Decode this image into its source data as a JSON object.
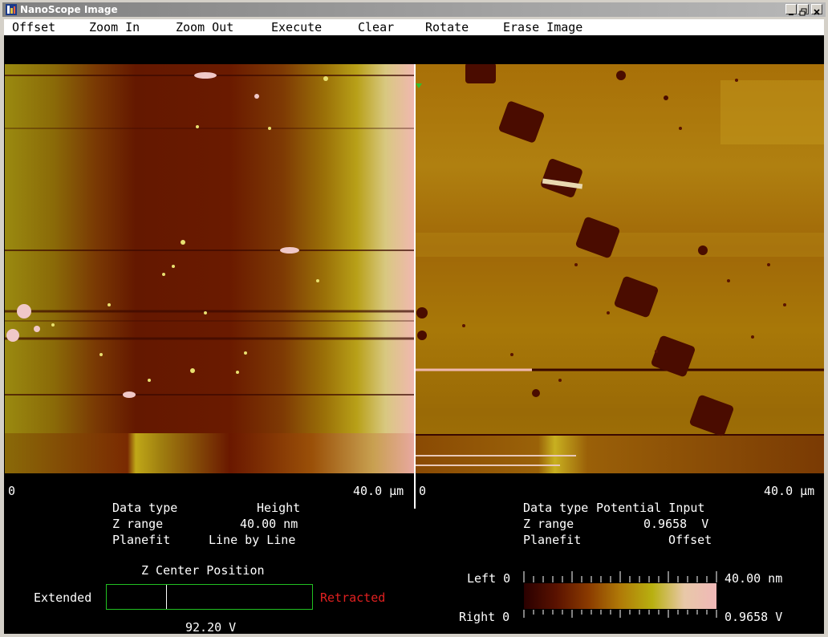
{
  "window": {
    "title": "NanoScope Image",
    "controls": [
      "minimize",
      "restore",
      "close"
    ]
  },
  "menu": {
    "items": [
      "Offset",
      "Zoom In",
      "Zoom Out",
      "Execute",
      "Clear",
      "Rotate",
      "Erase Image"
    ]
  },
  "left_image": {
    "scale_start": "0",
    "scale_end": "40.0 µm",
    "data_type_label": "Data type",
    "data_type_value": "Height",
    "z_range_label": "Z range",
    "z_range_value": "40.00 nm",
    "planefit_label": "Planefit",
    "planefit_value": "Line by Line"
  },
  "right_image": {
    "scale_start": "0",
    "scale_end": "40.0 µm",
    "data_type_label": "Data type",
    "data_type_value": "Potential Input",
    "z_range_label": "Z range",
    "z_range_value": "0.9658  V",
    "planefit_label": "Planefit",
    "planefit_value": "Offset"
  },
  "z_center": {
    "title": "Z Center Position",
    "extended_label": "Extended",
    "retracted_label": "Retracted",
    "voltage": "92.20 V",
    "position_fraction": 0.29
  },
  "colorbar": {
    "left_label": "Left 0",
    "right_label": "Right 0",
    "top_value": "40.00 nm",
    "bottom_value": "0.9658 V",
    "colors": [
      "#2a0000",
      "#5a1200",
      "#8a3a00",
      "#b07a08",
      "#b8b010",
      "#e8c8a8",
      "#f0b8b8"
    ]
  },
  "colors": {
    "accent_green": "#22c022",
    "retracted_red": "#e02020",
    "title_gradient_start": "#808080"
  }
}
